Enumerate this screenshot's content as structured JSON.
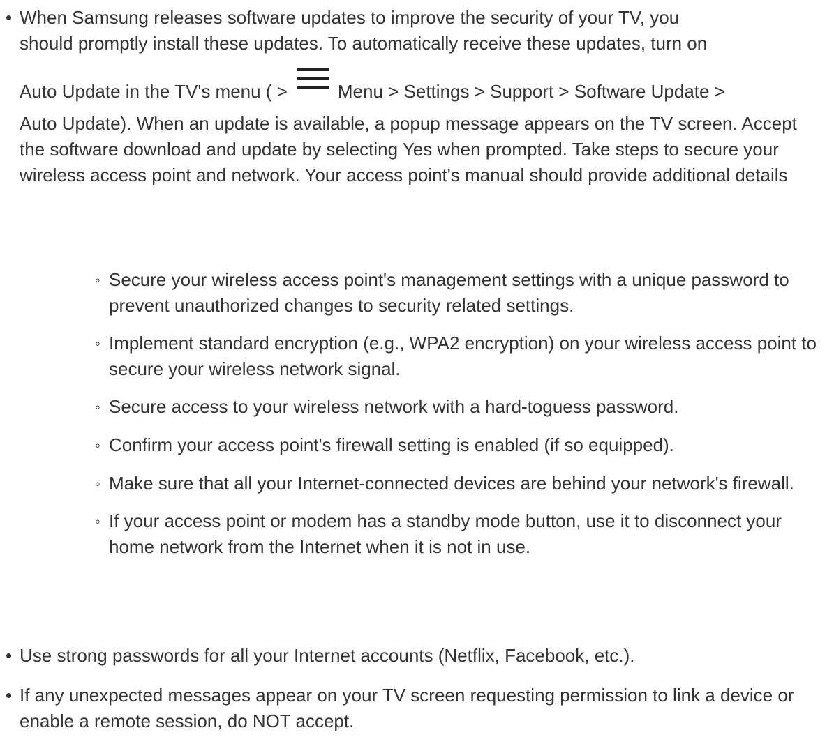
{
  "bullets": {
    "main_marker": "•",
    "sub_marker": "◦"
  },
  "intro": {
    "line1": "When Samsung releases software updates to improve the security of your TV, you",
    "line2": "should promptly install these updates. To automatically receive these updates, turn on",
    "line3_before_icon": "Auto Update in the TV's menu ( >",
    "line3_after_icon": "Menu > Settings > Support > Software Update >",
    "rest": "Auto Update). When an update is available, a popup message appears on the TV screen. Accept the software download and update by selecting Yes when prompted. Take steps to secure your wireless access point and network. Your access point's manual should provide additional details",
    "icon": "menu-hamburger-icon"
  },
  "sub_items": [
    "Secure your wireless access point's management settings with a unique password to prevent unauthorized changes to security related settings.",
    "Implement standard encryption (e.g., WPA2 encryption) on your wireless access point to secure your wireless network signal.",
    "Secure access to your wireless network with a hard-toguess password.",
    "Confirm your access point's firewall setting is enabled (if so equipped).",
    "Make sure that all your Internet-connected devices are behind your network's firewall.",
    "If your access point or modem has a standby mode button, use it to disconnect your home network from the Internet when it is not in use."
  ],
  "bottom_items": [
    "Use strong passwords for all your Internet accounts (Netflix, Facebook, etc.).",
    "If any unexpected messages appear on your TV screen requesting permission to link a device or enable a remote session, do NOT accept."
  ]
}
